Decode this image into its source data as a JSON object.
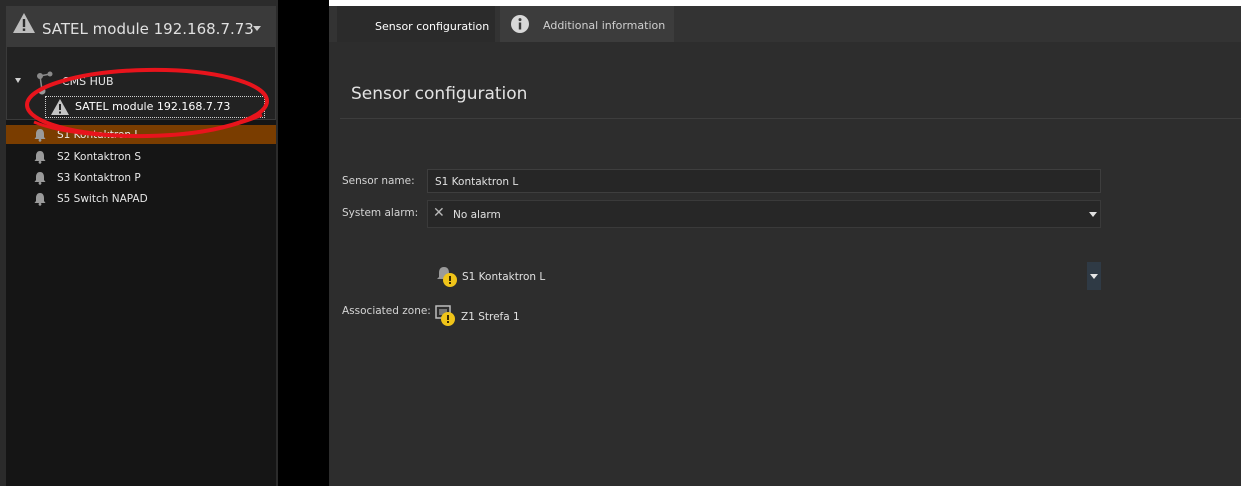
{
  "sidebar": {
    "selector": {
      "label": "SATEL module 192.168.7.73",
      "icon": "warning-icon"
    },
    "tree": {
      "hub_label": "CMS HUB",
      "hub_icon": "hub-icon",
      "selected_node_label": "SATEL module 192.168.7.73"
    },
    "sensors": [
      {
        "label": "S1 Kontaktron L",
        "icon": "bell-icon",
        "selected": true
      },
      {
        "label": "S2 Kontaktron S",
        "icon": "bell-icon",
        "selected": false
      },
      {
        "label": "S3 Kontaktron P",
        "icon": "bell-icon",
        "selected": false
      },
      {
        "label": "S5 Switch NAPAD",
        "icon": "bell-icon",
        "selected": false
      }
    ]
  },
  "tabs": [
    {
      "label": "Sensor configuration",
      "active": true
    },
    {
      "label": "Additional information",
      "active": false,
      "icon": "info-icon"
    }
  ],
  "main": {
    "title": "Sensor configuration",
    "sensor_name_label": "Sensor name:",
    "sensor_name_value": "S1 Kontaktron L",
    "system_alarm_label": "System alarm:",
    "system_alarm_value": "No alarm",
    "associated_zone_label": "Associated zone:",
    "zone_sensor_label": "S1 Kontaktron L",
    "zone_label": "Z1 Strefa 1"
  },
  "colors": {
    "selection": "#7a3d00",
    "highlight_oval": "#e8141c",
    "warning": "#f0c419"
  }
}
